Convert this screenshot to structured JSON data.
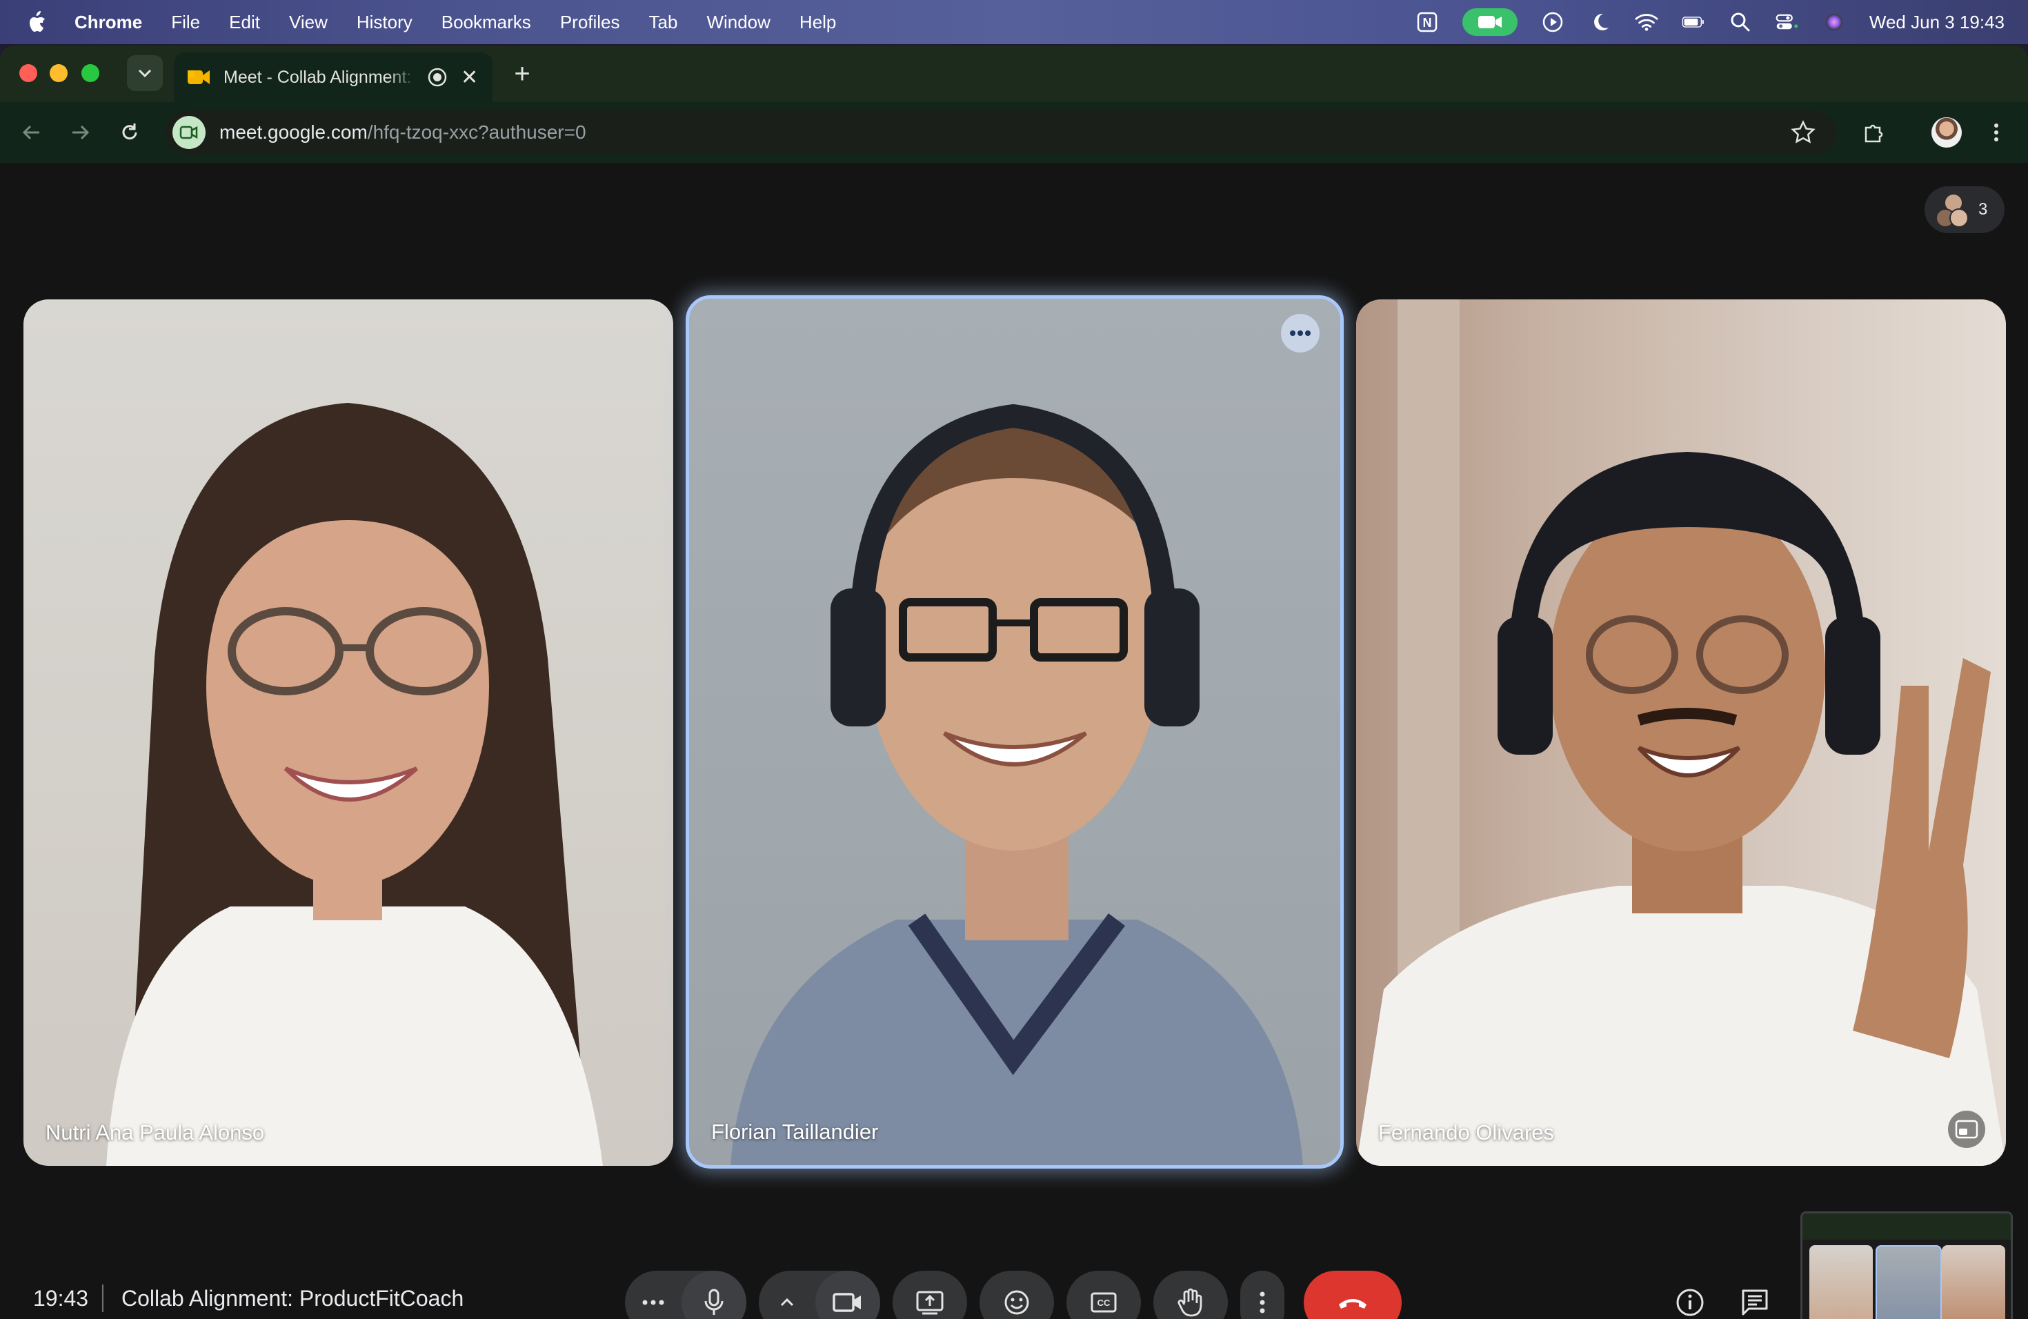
{
  "menubar": {
    "app_name": "Chrome",
    "menus": [
      "File",
      "Edit",
      "View",
      "History",
      "Bookmarks",
      "Profiles",
      "Tab",
      "Window",
      "Help"
    ],
    "clock": "Wed Jun 3  19:43",
    "icons": [
      "notion-icon",
      "facetime-camera-icon",
      "play-icon",
      "moon-icon",
      "wifi-icon",
      "battery-icon",
      "search-icon",
      "control-center-icon",
      "siri-icon"
    ]
  },
  "browser": {
    "tab": {
      "title": "Meet - Collab Alignment: ProductFitCoach"
    },
    "url_host": "meet.google.com",
    "url_path": "/hfq-tzoq-xxc?authuser=0"
  },
  "meet": {
    "participant_count": "3",
    "tiles": [
      {
        "name": "Nutri Ana Paula Alonso"
      },
      {
        "name": "Florian Taillandier"
      },
      {
        "name": "Fernando Olivares"
      }
    ],
    "time": "19:43",
    "meeting_title": "Collab Alignment: ProductFitCoach",
    "controls": [
      "more-audio-options",
      "microphone",
      "more-video-options",
      "camera",
      "present-screen",
      "emoji-reactions",
      "captions",
      "raise-hand",
      "more-options",
      "leave-call"
    ],
    "side_controls": [
      "meeting-details",
      "chat"
    ]
  },
  "colors": {
    "end_call": "#dc362e",
    "active_speaker_border": "#a8c7fa",
    "control_bg": "#333537",
    "facetime_green": "#3ac26a"
  }
}
